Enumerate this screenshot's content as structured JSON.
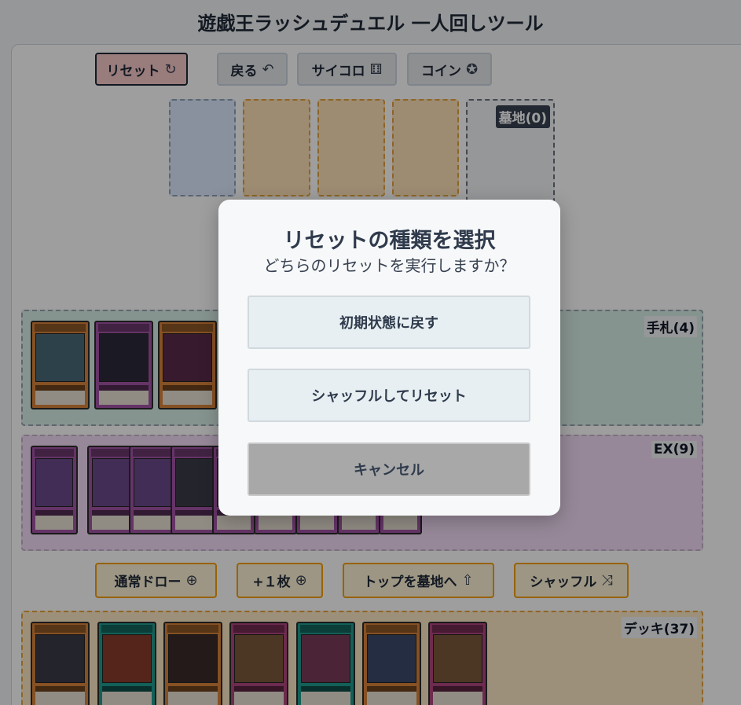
{
  "app": {
    "title": "遊戯王ラッシュデュエル 一人回しツール"
  },
  "toolbar": {
    "reset_label": "リセット",
    "reset_icon": "↻",
    "back_label": "戻る",
    "back_icon": "↶",
    "dice_label": "サイコロ",
    "dice_icon": "⚅",
    "coin_label": "コイン",
    "coin_icon": "✪"
  },
  "zones": {
    "graveyard_label": "墓地(0)"
  },
  "hand": {
    "label": "手札(4)"
  },
  "extra": {
    "label": "EX(9)"
  },
  "deck": {
    "label": "デッキ(37)"
  },
  "deck_controls": {
    "draw_label": "通常ドロー",
    "draw_icon": "⊕",
    "plus_one_label": "+１枚",
    "plus_one_icon": "⊕",
    "mill_label": "トップを墓地へ",
    "mill_icon": "⇧",
    "shuffle_label": "シャッフル",
    "shuffle_icon": "⤨"
  },
  "modal": {
    "title": "リセットの種類を選択",
    "subtitle": "どちらのリセットを実行しますか？",
    "initial_state_label": "初期状態に戻す",
    "shuffle_reset_label": "シャッフルしてリセット",
    "cancel_label": "キャンセル"
  },
  "colors": {
    "reset_button_bg": "#f7c8c8",
    "hand_area_bg": "#d8efe9",
    "extra_area_bg": "#f3dcf5",
    "deck_area_bg": "#fde9c6",
    "monster_frame": "#d9843b",
    "fusion_frame": "#a455a6",
    "spell_frame": "#1f9b8f",
    "trap_frame": "#b0467f"
  }
}
